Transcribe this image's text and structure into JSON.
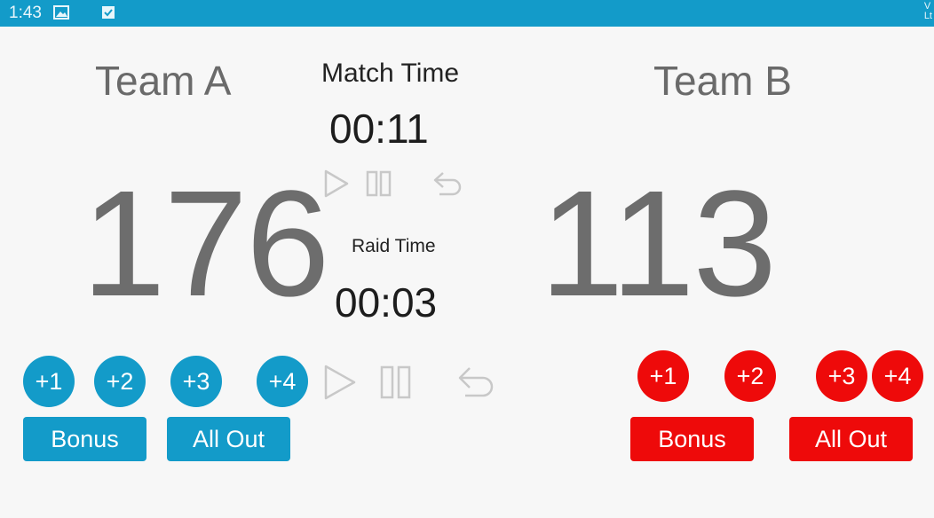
{
  "status_bar": {
    "time": "1:43",
    "icons": [
      "image-icon",
      "check-box-icon"
    ],
    "edge_text": "V\nLt"
  },
  "team_a": {
    "name": "Team A",
    "score": "176",
    "point_buttons": [
      "+1",
      "+2",
      "+3",
      "+4"
    ],
    "bonus_label": "Bonus",
    "all_out_label": "All Out",
    "color": "#139bc9"
  },
  "team_b": {
    "name": "Team B",
    "score": "113",
    "point_buttons": [
      "+1",
      "+2",
      "+3",
      "+4"
    ],
    "bonus_label": "Bonus",
    "all_out_label": "All Out",
    "color": "#ee0a0a"
  },
  "match_timer": {
    "title": "Match Time",
    "value": "00:11",
    "controls": [
      "play-icon",
      "pause-icon",
      "undo-icon"
    ]
  },
  "raid_timer": {
    "title": "Raid Time",
    "value": "00:03",
    "controls": [
      "play-icon",
      "pause-icon",
      "undo-icon"
    ]
  },
  "colors": {
    "status_bar": "#139bc9",
    "score_text": "#6d6d6d",
    "control_icon": "#c8c8c8"
  }
}
